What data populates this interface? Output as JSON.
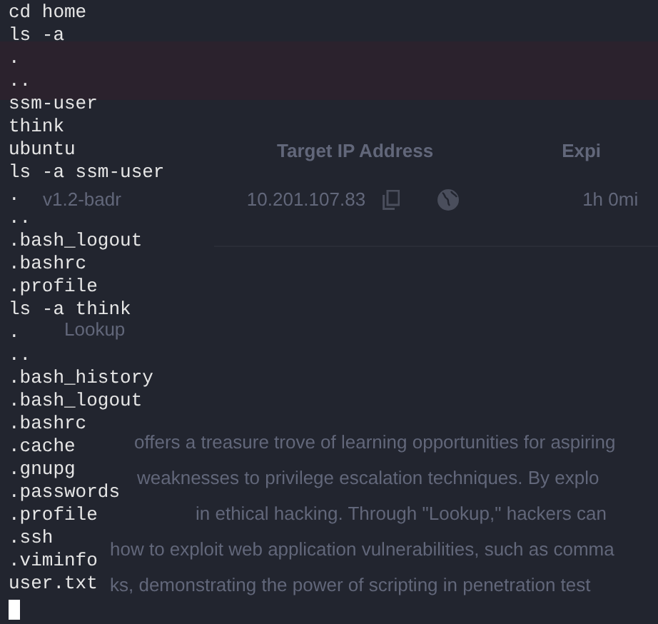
{
  "background_page": {
    "columns": [
      "Target IP Address",
      "Expi"
    ],
    "machine": {
      "name": "v1.2-badr",
      "ip": "10.201.107.83",
      "expires": "1h 0mi"
    },
    "section_title": "Lookup",
    "description_lines": [
      "offers a treasure trove of learning opportunities for aspiring",
      "weaknesses to privilege escalation techniques. By explo",
      "in ethical hacking. Through \"Lookup,\" hackers can",
      "how to exploit web application vulnerabilities, such as comma",
      "ks, demonstrating the power of scripting in penetration test"
    ]
  },
  "terminal": {
    "lines": [
      "cd home",
      "ls -a",
      ".",
      "..",
      "ssm-user",
      "think",
      "ubuntu",
      "ls -a ssm-user",
      ".",
      "..",
      ".bash_logout",
      ".bashrc",
      ".profile",
      "ls -a think",
      ".",
      "..",
      ".bash_history",
      ".bash_logout",
      ".bashrc",
      ".cache",
      ".gnupg",
      ".passwords",
      ".profile",
      ".ssh",
      ".viminfo",
      "user.txt"
    ],
    "cursor": true
  }
}
